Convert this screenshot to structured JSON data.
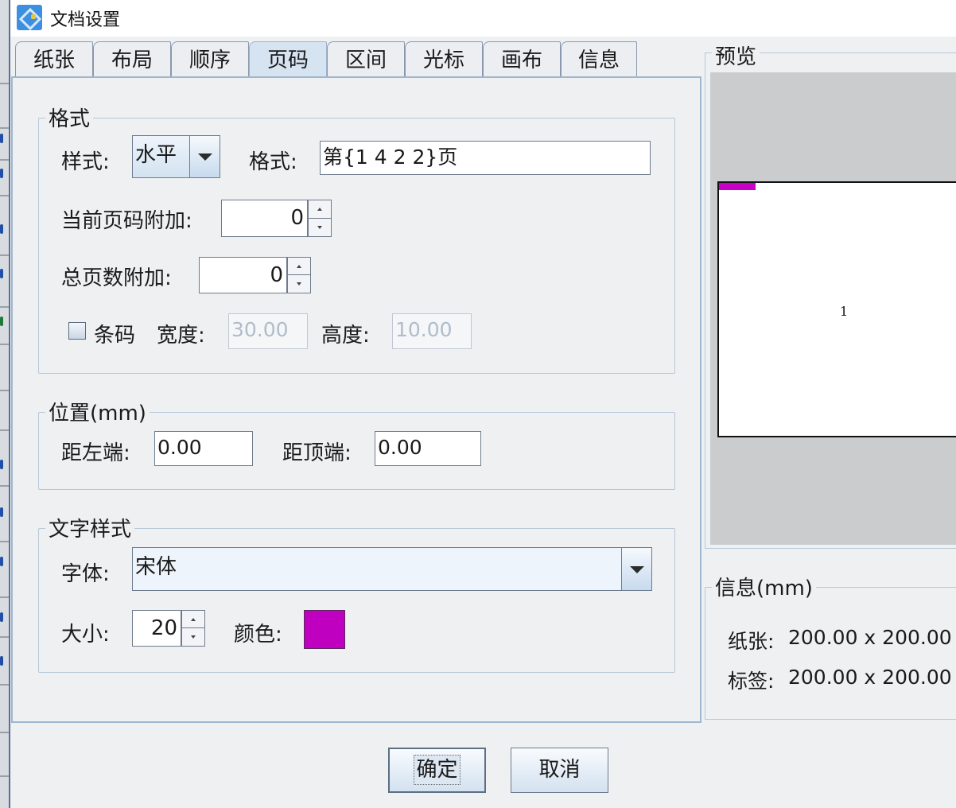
{
  "window": {
    "title": "文档设置",
    "icon": "app-logo-icon"
  },
  "tabs": [
    {
      "label": "纸张",
      "active": false
    },
    {
      "label": "布局",
      "active": false
    },
    {
      "label": "顺序",
      "active": false
    },
    {
      "label": "页码",
      "active": true
    },
    {
      "label": "区间",
      "active": false
    },
    {
      "label": "光标",
      "active": false
    },
    {
      "label": "画布",
      "active": false
    },
    {
      "label": "信息",
      "active": false
    }
  ],
  "format_group": {
    "title": "格式",
    "style_label": "样式:",
    "style_value": "水平",
    "format_label": "格式:",
    "format_value": "第{1 4 2 2}页",
    "current_page_add_label": "当前页码附加:",
    "current_page_add_value": "0",
    "total_pages_add_label": "总页数附加:",
    "total_pages_add_value": "0",
    "barcode_label": "条码",
    "barcode_checked": false,
    "width_label": "宽度:",
    "width_value": "30.00",
    "height_label": "高度:",
    "height_value": "10.00"
  },
  "position_group": {
    "title": "位置(mm)",
    "left_label": "距左端:",
    "left_value": "0.00",
    "top_label": "距顶端:",
    "top_value": "0.00"
  },
  "text_style_group": {
    "title": "文字样式",
    "font_label": "字体:",
    "font_value": "宋体",
    "size_label": "大小:",
    "size_value": "20",
    "color_label": "颜色:",
    "color_value": "#c000c0"
  },
  "preview": {
    "title": "预览",
    "page_number_text": "1",
    "marker_color": "#c800c8"
  },
  "info": {
    "title": "信息(mm)",
    "paper_label": "纸张:",
    "paper_value": "200.00 x 200.00",
    "label_label": "标签:",
    "label_value": "200.00 x 200.00"
  },
  "buttons": {
    "ok": "确定",
    "cancel": "取消"
  }
}
